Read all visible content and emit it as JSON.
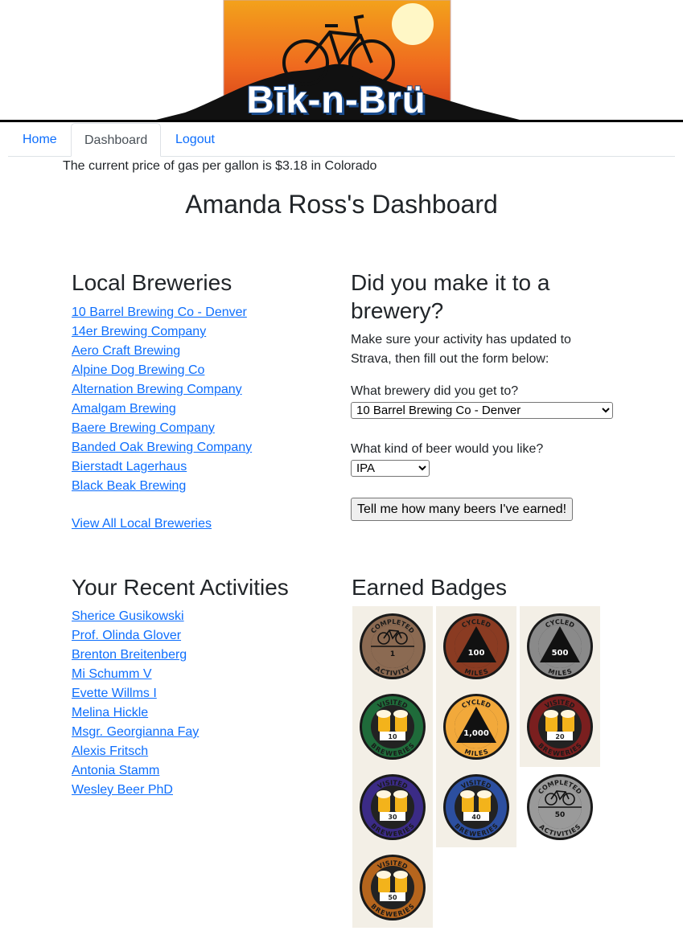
{
  "header": {
    "logo_text": "Bīk-n-Brü"
  },
  "nav": {
    "home": "Home",
    "dashboard": "Dashboard",
    "logout": "Logout"
  },
  "gas_notice": "The current price of gas per gallon is $3.18 in Colorado",
  "page_title": "Amanda Ross's Dashboard",
  "local_breweries": {
    "heading": "Local Breweries",
    "items": [
      "10 Barrel Brewing Co - Denver",
      "14er Brewing Company",
      "Aero Craft Brewing",
      "Alpine Dog Brewing Co",
      "Alternation Brewing Company",
      "Amalgam Brewing",
      "Baere Brewing Company",
      "Banded Oak Brewing Company",
      "Bierstadt Lagerhaus",
      "Black Beak Brewing"
    ],
    "view_all": "View All Local Breweries"
  },
  "brewery_form": {
    "heading": "Did you make it to a brewery?",
    "intro_line1": "Make sure your activity has updated to",
    "intro_line2": "Strava, then fill out the form below:",
    "brewery_question": "What brewery did you get to?",
    "brewery_selected": "10 Barrel Brewing Co - Denver",
    "beer_question": "What kind of beer would you like?",
    "beer_selected": "IPA",
    "submit": "Tell me how many beers I've earned!"
  },
  "recent_activities": {
    "heading": "Your Recent Activities",
    "items": [
      "Sherice Gusikowski",
      "Prof. Olinda Glover",
      "Brenton Breitenberg",
      "Mi Schumm V",
      "Evette Willms I",
      "Melina Hickle",
      "Msgr. Georgianna Fay",
      "Alexis Fritsch",
      "Antonia Stamm",
      "Wesley Beer PhD"
    ]
  },
  "badges": {
    "heading": "Earned Badges",
    "columns": [
      [
        {
          "kind": "activity",
          "top": "COMPLETED",
          "bottom": "ACTIVITY",
          "number": "1",
          "color": "#8b6a52"
        },
        {
          "kind": "brewery",
          "top": "VISITED",
          "bottom": "BREWERIES",
          "number": "10",
          "color": "#1f6b3a"
        },
        {
          "kind": "brewery",
          "top": "VISITED",
          "bottom": "BREWERIES",
          "number": "30",
          "color": "#3b2b86"
        },
        {
          "kind": "brewery",
          "top": "VISITED",
          "bottom": "BREWERIES",
          "number": "50",
          "color": "#b5651d"
        }
      ],
      [
        {
          "kind": "miles",
          "top": "CYCLED",
          "bottom": "MILES",
          "number": "100",
          "color": "#8a3b22"
        },
        {
          "kind": "miles",
          "top": "CYCLED",
          "bottom": "MILES",
          "number": "1,000",
          "color": "#f2a93b"
        },
        {
          "kind": "brewery",
          "top": "VISITED",
          "bottom": "BREWERIES",
          "number": "40",
          "color": "#2c4fa0"
        }
      ],
      [
        {
          "kind": "miles",
          "top": "CYCLED",
          "bottom": "MILES",
          "number": "500",
          "color": "#8a8a8a"
        },
        {
          "kind": "brewery",
          "top": "VISITED",
          "bottom": "BREWERIES",
          "number": "20",
          "color": "#7a1f1f"
        },
        {
          "kind": "activity",
          "top": "COMPLETED",
          "bottom": "ACTIVITIES",
          "number": "50",
          "color": "#9a9a9a"
        }
      ]
    ]
  },
  "colors": {
    "link": "#0d6efd",
    "text": "#212529"
  }
}
